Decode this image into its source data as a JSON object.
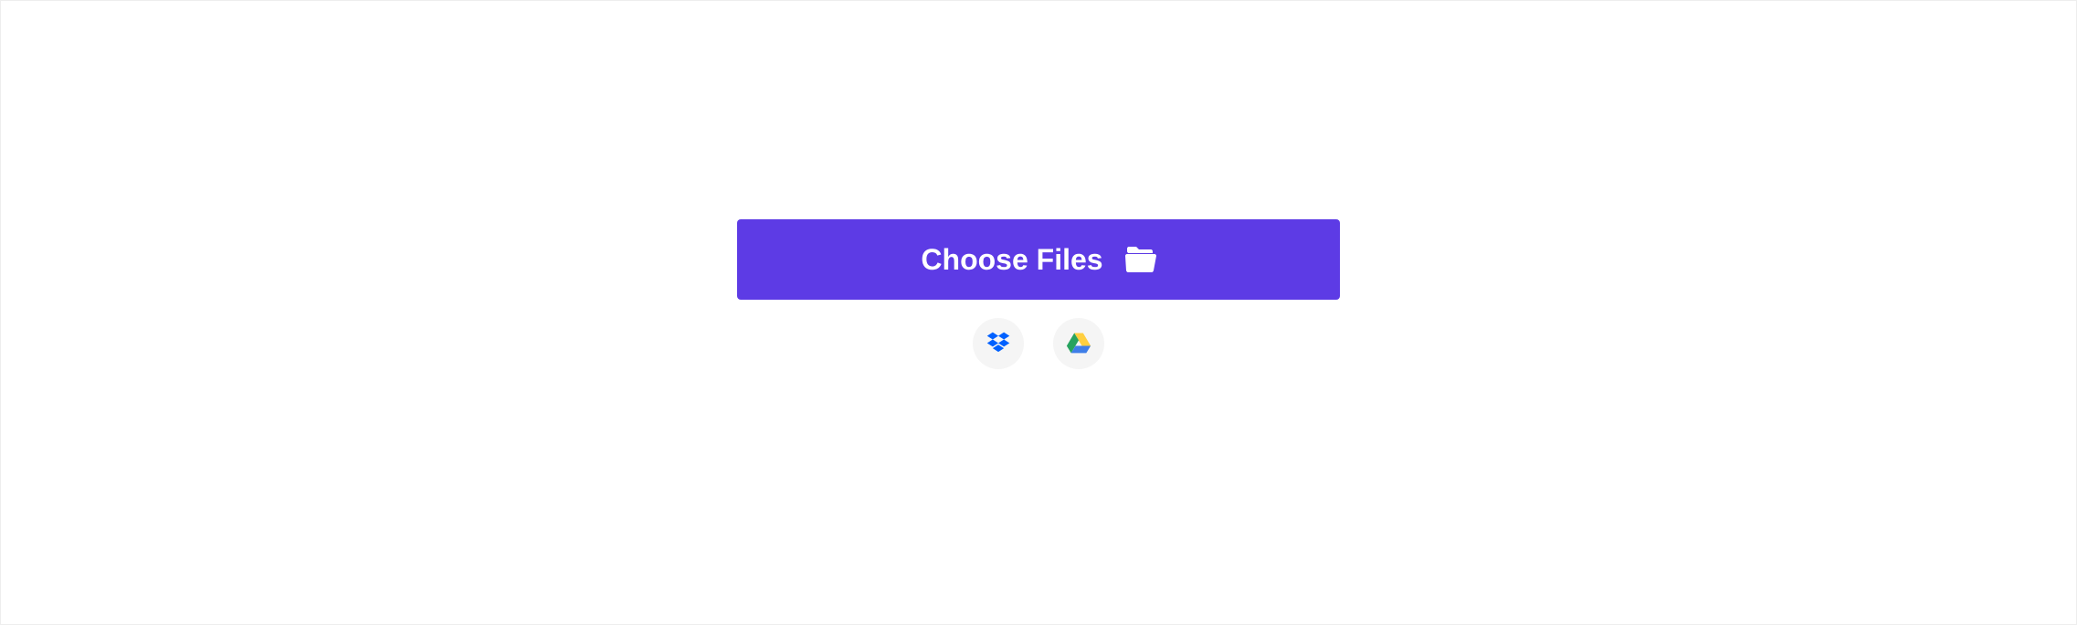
{
  "upload": {
    "choose_files_label": "Choose Files",
    "sources": {
      "dropbox_label": "Dropbox",
      "google_drive_label": "Google Drive"
    }
  },
  "colors": {
    "primary": "#5d3be5",
    "button_bg": "#f5f5f5"
  }
}
